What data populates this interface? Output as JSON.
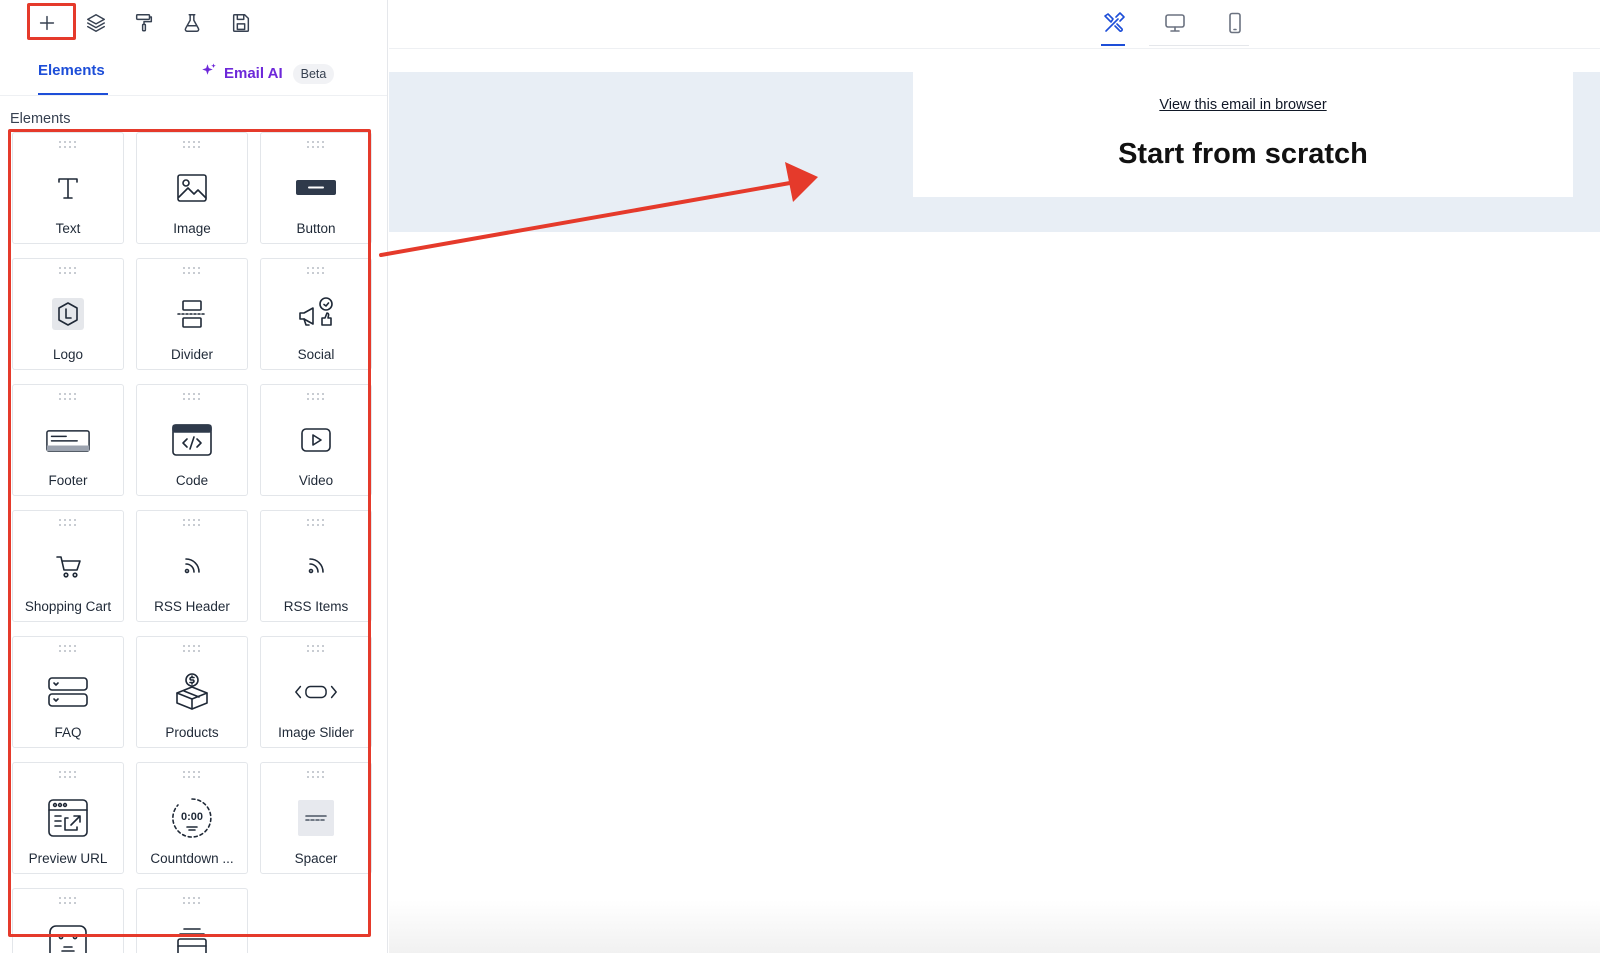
{
  "toolbar": {
    "tools": [
      {
        "name": "add",
        "icon": "plus-icon",
        "highlighted": true
      },
      {
        "name": "layers",
        "icon": "layers-icon"
      },
      {
        "name": "paint",
        "icon": "paint-roller-icon"
      },
      {
        "name": "test",
        "icon": "flask-icon"
      },
      {
        "name": "save",
        "icon": "save-icon"
      }
    ]
  },
  "tabs": {
    "elements_label": "Elements",
    "email_ai_label": "Email AI",
    "beta_badge": "Beta",
    "active": "Elements"
  },
  "elements_section": {
    "title": "Elements",
    "items": [
      {
        "label": "Text",
        "icon": "text-icon"
      },
      {
        "label": "Image",
        "icon": "image-icon"
      },
      {
        "label": "Button",
        "icon": "button-icon"
      },
      {
        "label": "Logo",
        "icon": "logo-icon"
      },
      {
        "label": "Divider",
        "icon": "divider-icon"
      },
      {
        "label": "Social",
        "icon": "social-icon"
      },
      {
        "label": "Footer",
        "icon": "footer-icon"
      },
      {
        "label": "Code",
        "icon": "code-icon"
      },
      {
        "label": "Video",
        "icon": "video-icon"
      },
      {
        "label": "Shopping Cart",
        "icon": "shopping-cart-icon"
      },
      {
        "label": "RSS Header",
        "icon": "rss-icon"
      },
      {
        "label": "RSS Items",
        "icon": "rss-icon"
      },
      {
        "label": "FAQ",
        "icon": "faq-icon"
      },
      {
        "label": "Products",
        "icon": "products-icon"
      },
      {
        "label": "Image Slider",
        "icon": "image-slider-icon"
      },
      {
        "label": "Preview URL",
        "icon": "preview-url-icon"
      },
      {
        "label": "Countdown ...",
        "icon": "countdown-icon",
        "icon_text": "0:00"
      },
      {
        "label": "Spacer",
        "icon": "spacer-icon"
      },
      {
        "label": "",
        "icon": "link-icon"
      },
      {
        "label": "",
        "icon": "stack-icon"
      }
    ]
  },
  "device_bar": {
    "modes": [
      {
        "name": "edit",
        "icon": "tools-icon",
        "active": true
      },
      {
        "name": "desktop",
        "icon": "desktop-icon"
      },
      {
        "name": "mobile",
        "icon": "mobile-icon"
      }
    ]
  },
  "canvas": {
    "browser_link": "View this email in browser",
    "heading": "Start from scratch",
    "band_color": "#e8eef5"
  },
  "annotations": {
    "color": "#e53a2b"
  },
  "colors": {
    "accent": "#1d4ed8",
    "ai_purple": "#6d28d9"
  }
}
